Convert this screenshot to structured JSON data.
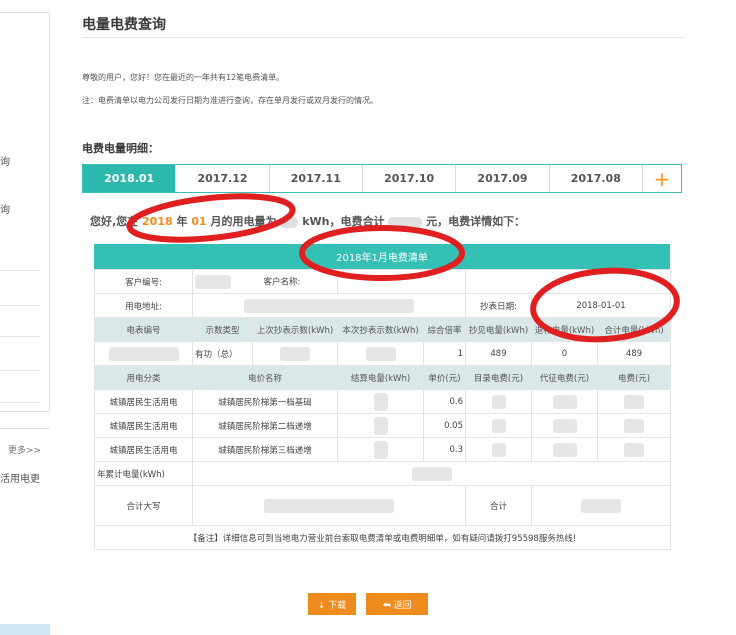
{
  "sidebar": {
    "frag1": "询",
    "frag2": "询",
    "more": "更多>>",
    "frag3": "活用电更"
  },
  "page": {
    "title": "电量电费查询",
    "notice1": "尊敬的用户，您好！您在最近的一年共有12笔电费清单。",
    "notice2": "注：电费清单以电力公司发行日期为准进行查询，存在单月发行或双月发行的情况。",
    "detail_heading": "电费电量明细："
  },
  "tabs": [
    "2018.01",
    "2017.12",
    "2017.11",
    "2017.10",
    "2017.09",
    "2017.08"
  ],
  "tab_plus": "+",
  "summary": {
    "prefix": "您好,您在",
    "year": "2018",
    "year_unit": "年",
    "month": "01",
    "mid": "月的用电量为",
    "kwh": "kWh，电费合计",
    "tail": "元，电费详情如下："
  },
  "bill": {
    "title": "2018年1月电费清单",
    "customer_no_label": "客户编号:",
    "customer_name_label": "客户名称:",
    "address_label": "用电地址:",
    "read_date_label": "抄表日期:",
    "read_date": "2018-01-01",
    "meter_headers": [
      "电表编号",
      "示数类型",
      "上次抄表示数(kWh)",
      "本次抄表示数(kWh)",
      "综合倍率",
      "抄见电量(kWh)",
      "退补电量(kWh)",
      "合计电量(kWh)"
    ],
    "meter_row": {
      "type": "有功（总）",
      "ratio": "1",
      "reading": "489",
      "refund": "0",
      "total": "489"
    },
    "price_headers": [
      "用电分类",
      "电价名称",
      "结算电量(kWh)",
      "单价(元)",
      "目录电费(元)",
      "代征电费(元)",
      "电费(元)"
    ],
    "price_rows": [
      {
        "category": "城镇居民生活用电",
        "name": "城镇居民阶梯第一档基础",
        "unit": "0.6"
      },
      {
        "category": "城镇居民生活用电",
        "name": "城镇居民阶梯第二档递增",
        "unit": "0.05"
      },
      {
        "category": "城镇居民生活用电",
        "name": "城镇居民阶梯第三档递增",
        "unit": "0.3"
      }
    ],
    "annual_label": "年累计电量(kWh)",
    "total_caps_label": "合计大写",
    "total_label": "合计",
    "footnote": "【备注】详细信息可到当地电力营业前台索取电费清单或电费明细单，如有疑问请拨打95598服务热线!"
  },
  "buttons": {
    "download": "↓ 下载",
    "back": "⮪ 返回"
  },
  "colors": {
    "accent": "#2db8ad",
    "highlight": "#f08c1e",
    "annotation": "#e02020"
  }
}
